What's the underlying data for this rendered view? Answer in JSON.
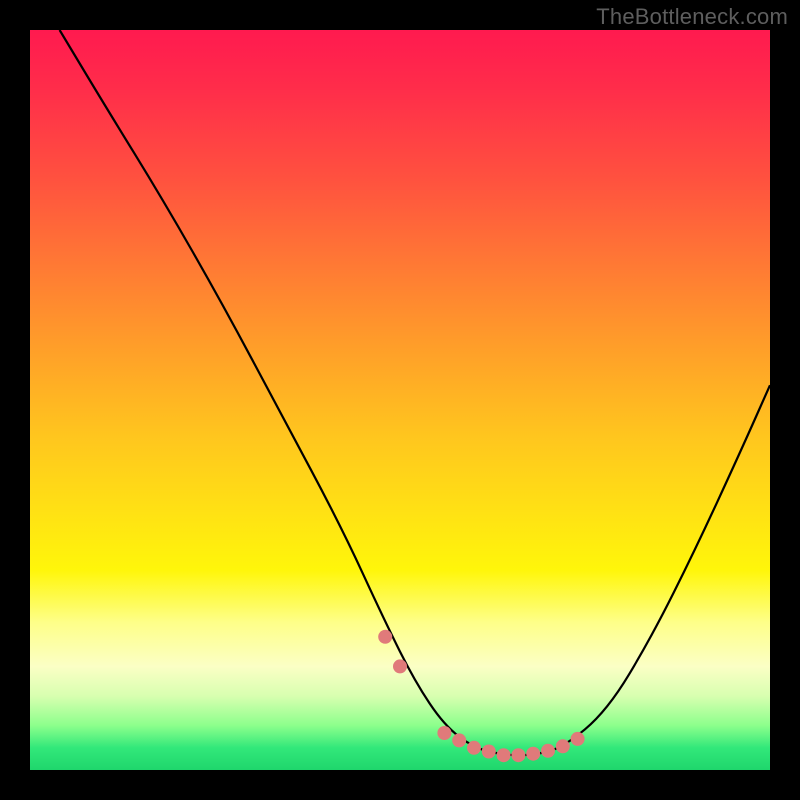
{
  "watermark": "TheBottleneck.com",
  "chart_data": {
    "type": "line",
    "title": "",
    "xlabel": "",
    "ylabel": "",
    "xlim": [
      0,
      100
    ],
    "ylim": [
      0,
      100
    ],
    "series": [
      {
        "name": "bottleneck-curve",
        "x": [
          4,
          10,
          18,
          26,
          34,
          42,
          48,
          52,
          56,
          60,
          64,
          68,
          72,
          78,
          84,
          90,
          96,
          100
        ],
        "values": [
          100,
          90,
          77,
          63,
          48,
          33,
          20,
          12,
          6,
          3,
          2,
          2,
          3,
          8,
          18,
          30,
          43,
          52
        ]
      }
    ],
    "markers": {
      "name": "highlight-dots",
      "color": "#e07a7a",
      "x": [
        48,
        50,
        56,
        58,
        60,
        62,
        64,
        66,
        68,
        70,
        72,
        74
      ],
      "values": [
        18,
        14,
        5,
        4,
        3,
        2.5,
        2,
        2,
        2.2,
        2.6,
        3.2,
        4.2
      ]
    },
    "background_gradient": {
      "top": "#ff1a4f",
      "mid": "#ffe114",
      "bottom": "#1fd66c"
    }
  }
}
